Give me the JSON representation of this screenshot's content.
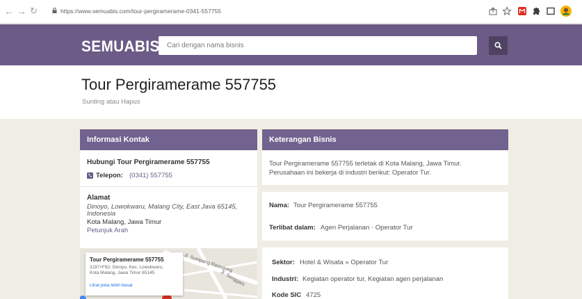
{
  "browser": {
    "url": "https://www.semuabis.com/tour-pergiramerame-0341-557755"
  },
  "header": {
    "logo": "SEMUABIS",
    "search_placeholder": "Cari dengan nama bisnis"
  },
  "title": {
    "name": "Tour Pergiramerame 557755",
    "edit": "Sunting atau Hapus"
  },
  "contact": {
    "header": "Informasi Kontak",
    "heading": "Hubungi Tour Pergiramerame 557755",
    "phone_label": "Telepon:",
    "phone": "(0341) 557755",
    "address_title": "Alamat",
    "address_line1": "Dinoyo, Lowokwaru, Malang City, East Java 65145,",
    "address_line2": "Indonesia",
    "address_city": "Kota Malang, Jawa Timur",
    "directions": "Petunjuk Arah"
  },
  "map": {
    "popup_title": "Tour Pergiramerame 557755",
    "popup_line1": "3J37+F92, Dinoyo, Kec. Lowokwaru,",
    "popup_line2": "Kota Malang, Jawa Timur 65145",
    "popup_link": "Lihat peta lebih besar",
    "street1": "Jl. Sumpang Remujung",
    "street2": "Jl. Senggani"
  },
  "business": {
    "header": "Keterangan Bisnis",
    "desc1": "Tour Pergiramerame 557755 terletak di Kota Malang, Jawa Timur.",
    "desc2": "Perusahaan ini bekerja di industri berikut: Operator Tur.",
    "name_label": "Nama:",
    "name_value": "Tour Pergiramerame 557755",
    "involved_label": "Terlibat dalam:",
    "involved_value": "Agen Perjalanan · Operator Tur",
    "sector_label": "Sektor:",
    "sector_value": "Hotel & Wisata » Operator Tur",
    "industry_label": "Industri:",
    "industry_value": "Kegiatan operator tur, Kegiatan agen perjalanan",
    "sic_label": "Kode SIC",
    "sic_value": "4725"
  }
}
